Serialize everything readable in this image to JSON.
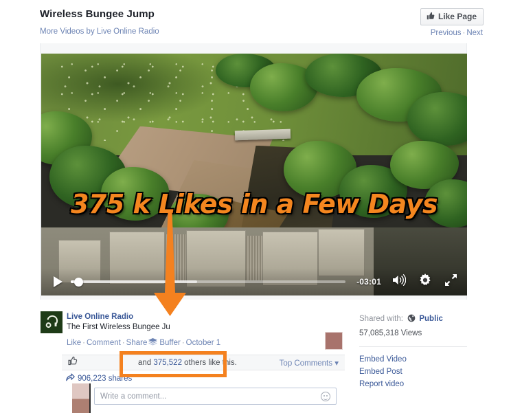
{
  "header": {
    "title": "Wireless Bungee Jump",
    "subtitle": "More Videos by Live Online Radio",
    "like_page_label": "Like Page",
    "like_icon": "thumbs-up-icon",
    "previous_label": "Previous",
    "next_label": "Next",
    "separator": "·"
  },
  "video": {
    "overlay_caption": "375 k Likes in a Few Days",
    "overlay_text_color": "#f4861f",
    "overlay_outline_color": "#000000",
    "time_remaining": "-03:01",
    "play_icon": "play-icon",
    "volume_icon": "volume-icon",
    "settings_icon": "gear-icon",
    "fullscreen_icon": "fullscreen-icon",
    "scrubber_icon": "scrubber-handle"
  },
  "post": {
    "avatar_icon": "headphones-icon",
    "page_name": "Live Online Radio",
    "text": "The First Wireless Bungee Ju",
    "actions": {
      "like": "Like",
      "comment": "Comment",
      "share": "Share",
      "buffer": "Buffer",
      "buffer_icon": "buffer-stack-icon",
      "date": "October 1",
      "separator": "·"
    },
    "likes_bar": {
      "thumb_icon": "thumbs-up-icon",
      "likes_prefix": "and ",
      "likes_count": "375,522",
      "likes_suffix": " others like this.",
      "sort_label": "Top Comments",
      "sort_caret": "▾"
    },
    "shares": {
      "share_icon": "share-arrow-icon",
      "text": "906,223 shares"
    },
    "comment_compose": {
      "placeholder": "Write a comment...",
      "emoji_icon": "emoji-icon",
      "avatar_icon": "user-avatar"
    }
  },
  "rail": {
    "shared_with_label": "Shared with:",
    "privacy_icon": "globe-icon",
    "privacy_value": "Public",
    "views": "57,085,318 Views",
    "links": [
      {
        "label": "Embed Video",
        "name": "embed-video-link"
      },
      {
        "label": "Embed Post",
        "name": "embed-post-link"
      },
      {
        "label": "Report video",
        "name": "report-video-link"
      }
    ],
    "color_chip": "#a8736c"
  },
  "annotations": {
    "arrow_color": "#f4811f",
    "highlight_box_color": "#f4811f"
  }
}
